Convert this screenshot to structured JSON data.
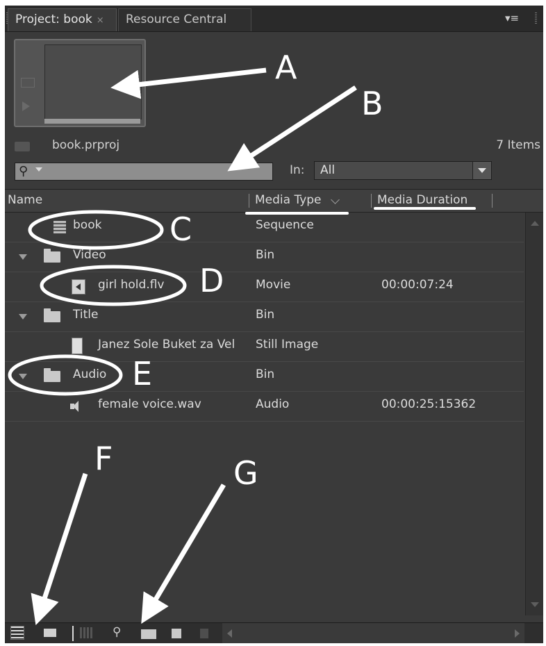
{
  "tabs": [
    {
      "label": "Project: book",
      "close": "×"
    },
    {
      "label": "Resource Central"
    }
  ],
  "panel_menu_icon": "panel-menu-icon",
  "project": {
    "file_name": "book.prproj",
    "items_count": "7 Items"
  },
  "search": {
    "placeholder": "",
    "in_label": "In:",
    "in_value": "All"
  },
  "columns": {
    "name": "Name",
    "media_type": "Media Type",
    "media_duration": "Media Duration"
  },
  "rows": [
    {
      "name": "book",
      "type": "Sequence",
      "duration": "",
      "icon": "sequence-icon"
    },
    {
      "name": "Video",
      "type": "Bin",
      "duration": "",
      "icon": "folder-icon"
    },
    {
      "name": "girl hold.flv",
      "type": "Movie",
      "duration": "00:00:07:24",
      "icon": "movie-icon"
    },
    {
      "name": "Title",
      "type": "Bin",
      "duration": "",
      "icon": "folder-icon"
    },
    {
      "name": "Janez Sole Buket za Vel",
      "type": "Still Image",
      "duration": "",
      "icon": "still-image-icon"
    },
    {
      "name": "Audio",
      "type": "Bin",
      "duration": "",
      "icon": "folder-icon"
    },
    {
      "name": "female voice.wav",
      "type": "Audio",
      "duration": "00:00:25:15362",
      "icon": "audio-icon"
    }
  ],
  "toolbar_icons": [
    "list-view-icon",
    "icon-view-icon",
    "automate-to-sequence-icon",
    "find-icon",
    "new-bin-icon",
    "new-item-icon",
    "clear-icon"
  ],
  "annotations": {
    "A": "A",
    "B": "B",
    "C": "C",
    "D": "D",
    "E": "E",
    "F": "F",
    "G": "G"
  },
  "colors": {
    "panel_bg": "#3a3a3a",
    "annotation": "#ffffff"
  }
}
